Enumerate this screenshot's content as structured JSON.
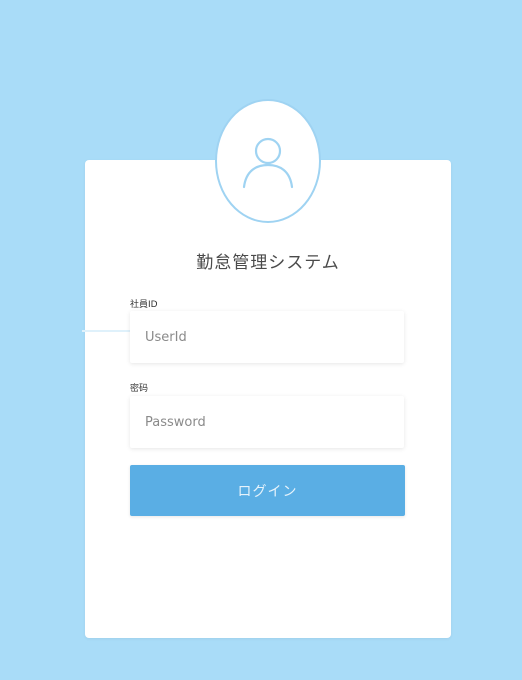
{
  "colors": {
    "background": "#a9dcf8",
    "card": "#ffffff",
    "accent": "#5aaee4",
    "avatar_ring": "#9fd3f2"
  },
  "login": {
    "title": "勤怠管理システム",
    "avatar_icon": "user-icon",
    "userid_label": "社員ID",
    "userid_placeholder": "UserId",
    "userid_value": "",
    "password_label": "密码",
    "password_placeholder": "Password",
    "password_value": "",
    "submit_label": "ログイン"
  }
}
